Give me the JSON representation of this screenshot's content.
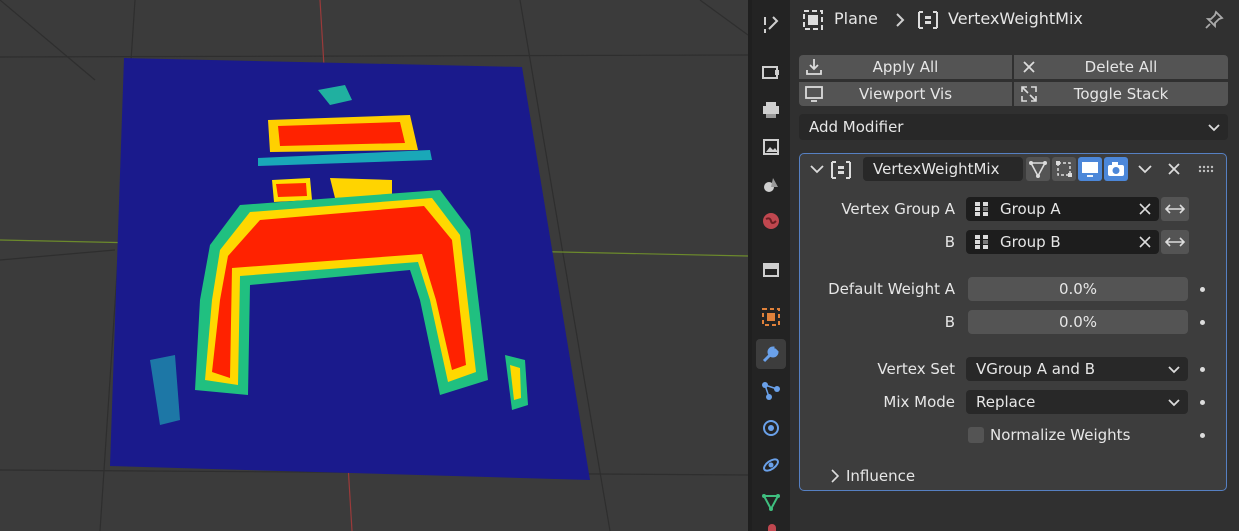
{
  "header": {
    "object_name": "Plane",
    "modifier_name": "VertexWeightMix",
    "object_icon": "plane-object-icon",
    "modifier_icon": "vertex-weight-mix-icon",
    "pin_icon": "pin-icon"
  },
  "toolbar": {
    "apply_all": "Apply All",
    "delete_all": "Delete All",
    "viewport_vis": "Viewport Vis",
    "toggle_stack": "Toggle Stack"
  },
  "add_modifier": {
    "label": "Add Modifier"
  },
  "modifier": {
    "name": "VertexWeightMix",
    "vertex_group_a_label": "Vertex Group A",
    "vertex_group_a_value": "Group A",
    "vertex_group_b_label": "B",
    "vertex_group_b_value": "Group B",
    "default_weight_a_label": "Default Weight A",
    "default_weight_a_value": "0.0%",
    "default_weight_b_label": "B",
    "default_weight_b_value": "0.0%",
    "vertex_set_label": "Vertex Set",
    "vertex_set_value": "VGroup A and B",
    "mix_mode_label": "Mix Mode",
    "mix_mode_value": "Replace",
    "normalize_label": "Normalize Weights",
    "normalize_checked": false,
    "influence_label": "Influence"
  },
  "property_tabs": [
    "tool-tab",
    "render-tab",
    "output-tab",
    "view-layer-tab",
    "scene-tab",
    "world-tab",
    "collection-tab",
    "object-tab",
    "modifiers-tab",
    "particles-tab",
    "physics-tab",
    "constraints-tab",
    "data-tab"
  ],
  "colors": {
    "accent": "#5680c2",
    "active_icon_blue": "#4c87d9",
    "weight_low": "#1a1a8c",
    "weight_high": "#ff2a00"
  }
}
